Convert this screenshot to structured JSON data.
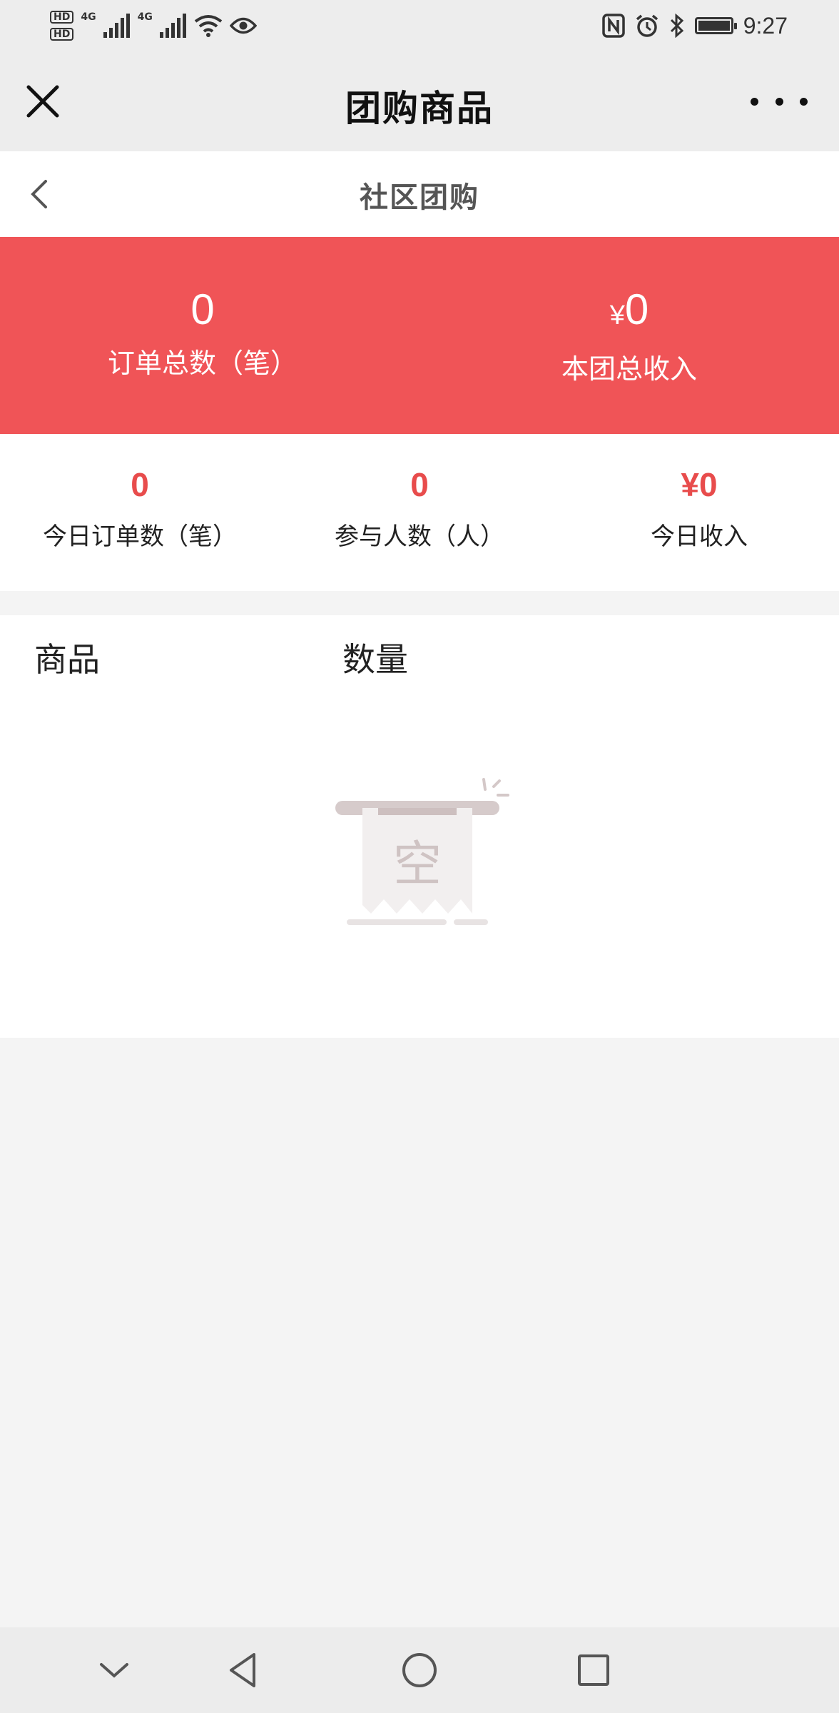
{
  "status_bar": {
    "hd1": "HD",
    "hd2": "HD",
    "network1": "4G",
    "network2": "4G",
    "time": "9:27",
    "icons": [
      "signal-icon",
      "wifi-icon",
      "eye-icon",
      "nfc-icon",
      "alarm-icon",
      "bluetooth-icon",
      "battery-icon"
    ]
  },
  "title_bar": {
    "title": "团购商品",
    "close_icon": "close-icon",
    "more_icon": "more-icon"
  },
  "header": {
    "title": "社区团购",
    "back_icon": "chevron-left-icon"
  },
  "summary": {
    "total_orders": {
      "value": "0",
      "label": "订单总数（笔）"
    },
    "total_income": {
      "currency": "¥",
      "value": "0",
      "label": "本团总收入"
    },
    "accent_color": "#f05457"
  },
  "today": [
    {
      "value": "0",
      "label": "今日订单数（笔）"
    },
    {
      "value": "0",
      "label": "参与人数（人）"
    },
    {
      "value": "¥0",
      "label": "今日收入"
    }
  ],
  "table": {
    "col_goods": "商品",
    "col_qty": "数量",
    "rows": [],
    "empty_text": "空"
  },
  "nav_bar": {
    "buttons": [
      "chevron-down-icon",
      "back-triangle-icon",
      "home-circle-icon",
      "recent-square-icon"
    ]
  }
}
